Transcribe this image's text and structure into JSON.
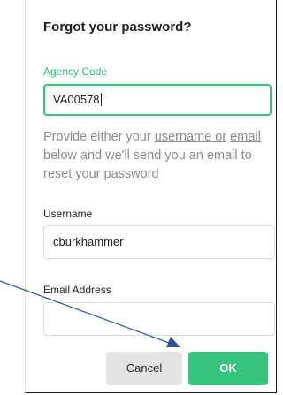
{
  "dialog": {
    "title": "Forgot your password?",
    "agency": {
      "label": "Agency Code",
      "value": "VA00578"
    },
    "help": {
      "before": "Provide either your ",
      "link_username": "username or",
      "space": " ",
      "link_email": "email",
      "after": " below and we'll send you an email to reset your password"
    },
    "username": {
      "label": "Username",
      "value": "cburkhammer"
    },
    "email": {
      "label": "Email Address",
      "value": ""
    },
    "buttons": {
      "cancel": "Cancel",
      "ok": "OK"
    }
  },
  "colors": {
    "accent": "#36c57c",
    "help_text": "#8c8c8c",
    "arrow": "#2f5597"
  }
}
